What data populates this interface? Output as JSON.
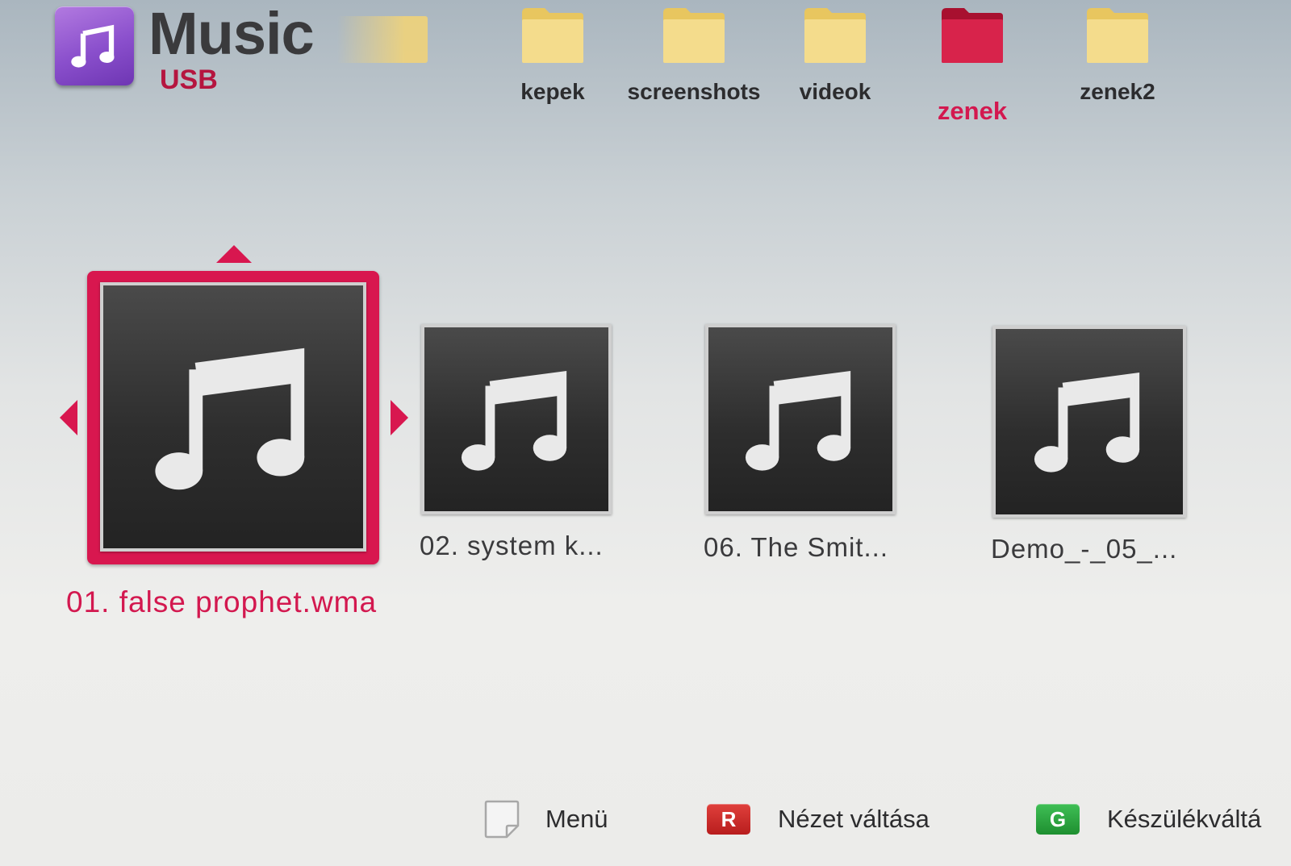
{
  "header": {
    "app_icon": "music-note-icon",
    "title": "Music",
    "source": "USB"
  },
  "folders": [
    {
      "label": "",
      "icon": "folder-icon",
      "state": "partial"
    },
    {
      "label": "kepek",
      "icon": "folder-icon",
      "state": "normal"
    },
    {
      "label": "screenshots",
      "icon": "folder-icon",
      "state": "normal"
    },
    {
      "label": "videok",
      "icon": "folder-icon",
      "state": "normal"
    },
    {
      "label": "zenek",
      "icon": "folder-icon",
      "state": "selected"
    },
    {
      "label": "zenek2",
      "icon": "folder-icon",
      "state": "normal"
    }
  ],
  "files": [
    {
      "label": "01. false prophet.wma",
      "icon": "music-note-icon",
      "selected": true
    },
    {
      "label": "02. system k...",
      "icon": "music-note-icon",
      "selected": false
    },
    {
      "label": "06. The Smit...",
      "icon": "music-note-icon",
      "selected": false
    },
    {
      "label": "Demo_-_05_...",
      "icon": "music-note-icon",
      "selected": false
    }
  ],
  "footer": {
    "menu_label": "Menü",
    "red_key": "R",
    "red_label": "Nézet váltása",
    "green_key": "G",
    "green_label": "Készülékváltá"
  },
  "colors": {
    "accent": "#d8174f",
    "folder_yellow": "#f0d37a",
    "folder_selected": "#d01a45",
    "app_icon_purple": "#8a4fcc",
    "key_red": "#c82828",
    "key_green": "#2aa23c"
  }
}
